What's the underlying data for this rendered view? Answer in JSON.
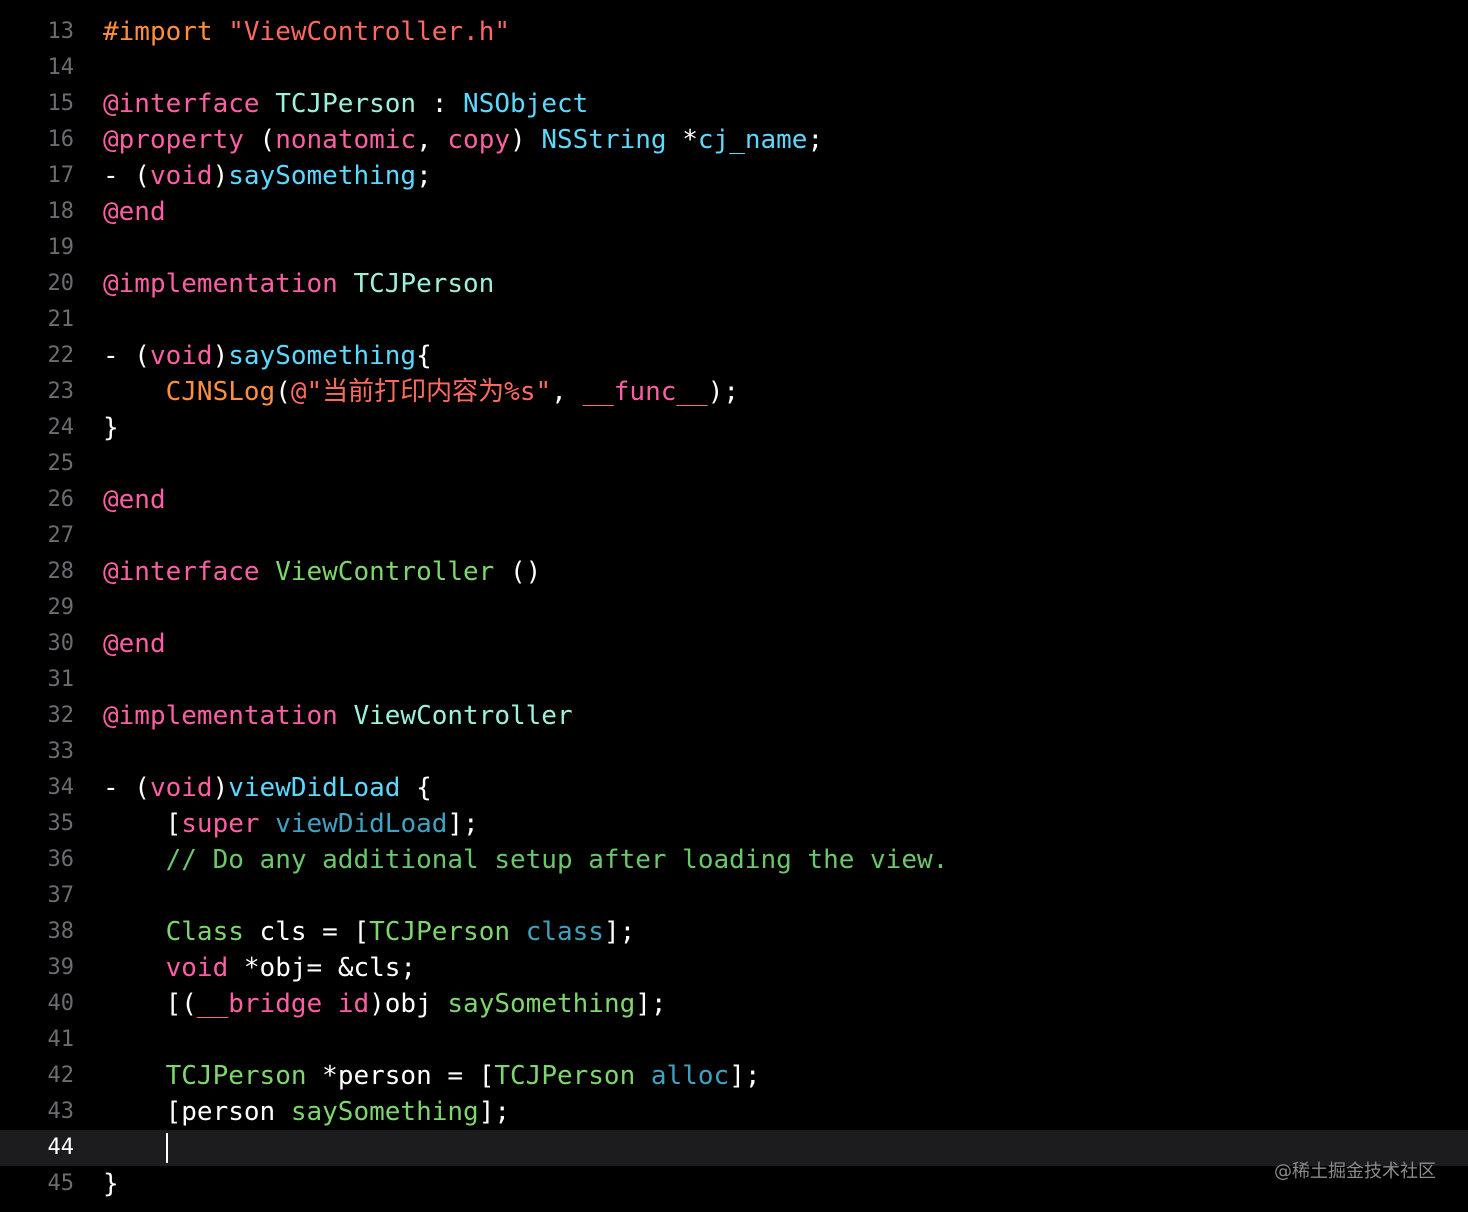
{
  "theme": {
    "background": "#000000",
    "current_line_background": "#1c1c1f",
    "line_number": "#6c6c72",
    "current_line_number": "#ffffff",
    "plain": "#ffffff",
    "keyword": "#fc5fa3",
    "string": "#fc6a5d",
    "comment": "#6bc76b",
    "type": "#5dd8ff",
    "class_name": "#9ef0dc",
    "project_name": "#67b7a4",
    "method_call": "#41a1c0",
    "preprocessor": "#fd8f3f",
    "green": "#7fd66f"
  },
  "editor": {
    "current_line": "44",
    "lines": [
      {
        "num": "13",
        "tokens": [
          {
            "t": "#import ",
            "c": "preprocessor"
          },
          {
            "t": "\"ViewController.h\"",
            "c": "string"
          }
        ]
      },
      {
        "num": "14",
        "tokens": []
      },
      {
        "num": "15",
        "tokens": [
          {
            "t": "@interface ",
            "c": "keyword"
          },
          {
            "t": "TCJPerson",
            "c": "class_name"
          },
          {
            "t": " : ",
            "c": "plain"
          },
          {
            "t": "NSObject",
            "c": "type"
          }
        ]
      },
      {
        "num": "16",
        "tokens": [
          {
            "t": "@property ",
            "c": "keyword"
          },
          {
            "t": "(",
            "c": "plain"
          },
          {
            "t": "nonatomic",
            "c": "keyword"
          },
          {
            "t": ", ",
            "c": "plain"
          },
          {
            "t": "copy",
            "c": "keyword"
          },
          {
            "t": ") ",
            "c": "plain"
          },
          {
            "t": "NSString",
            "c": "type"
          },
          {
            "t": " *",
            "c": "plain"
          },
          {
            "t": "cj_name",
            "c": "type"
          },
          {
            "t": ";",
            "c": "plain"
          }
        ]
      },
      {
        "num": "17",
        "tokens": [
          {
            "t": "- (",
            "c": "plain"
          },
          {
            "t": "void",
            "c": "keyword"
          },
          {
            "t": ")",
            "c": "plain"
          },
          {
            "t": "saySomething",
            "c": "type"
          },
          {
            "t": ";",
            "c": "plain"
          }
        ]
      },
      {
        "num": "18",
        "tokens": [
          {
            "t": "@end",
            "c": "keyword"
          }
        ]
      },
      {
        "num": "19",
        "tokens": []
      },
      {
        "num": "20",
        "tokens": [
          {
            "t": "@implementation ",
            "c": "keyword"
          },
          {
            "t": "TCJPerson",
            "c": "class_name"
          }
        ]
      },
      {
        "num": "21",
        "tokens": []
      },
      {
        "num": "22",
        "tokens": [
          {
            "t": "- (",
            "c": "plain"
          },
          {
            "t": "void",
            "c": "keyword"
          },
          {
            "t": ")",
            "c": "plain"
          },
          {
            "t": "saySomething",
            "c": "type"
          },
          {
            "t": "{",
            "c": "plain"
          }
        ]
      },
      {
        "num": "23",
        "tokens": [
          {
            "t": "    ",
            "c": "plain"
          },
          {
            "t": "CJNSLog",
            "c": "preprocessor"
          },
          {
            "t": "(",
            "c": "plain"
          },
          {
            "t": "@\"当前打印内容为%s\"",
            "c": "string"
          },
          {
            "t": ", ",
            "c": "plain"
          },
          {
            "t": "__func__",
            "c": "keyword"
          },
          {
            "t": ");",
            "c": "plain"
          }
        ]
      },
      {
        "num": "24",
        "tokens": [
          {
            "t": "}",
            "c": "plain"
          }
        ]
      },
      {
        "num": "25",
        "tokens": []
      },
      {
        "num": "26",
        "tokens": [
          {
            "t": "@end",
            "c": "keyword"
          }
        ]
      },
      {
        "num": "27",
        "tokens": []
      },
      {
        "num": "28",
        "tokens": [
          {
            "t": "@interface ",
            "c": "keyword"
          },
          {
            "t": "ViewController",
            "c": "green"
          },
          {
            "t": " ()",
            "c": "plain"
          }
        ]
      },
      {
        "num": "29",
        "tokens": []
      },
      {
        "num": "30",
        "tokens": [
          {
            "t": "@end",
            "c": "keyword"
          }
        ]
      },
      {
        "num": "31",
        "tokens": []
      },
      {
        "num": "32",
        "tokens": [
          {
            "t": "@implementation ",
            "c": "keyword"
          },
          {
            "t": "ViewController",
            "c": "class_name"
          }
        ]
      },
      {
        "num": "33",
        "tokens": []
      },
      {
        "num": "34",
        "tokens": [
          {
            "t": "- (",
            "c": "plain"
          },
          {
            "t": "void",
            "c": "keyword"
          },
          {
            "t": ")",
            "c": "plain"
          },
          {
            "t": "viewDidLoad",
            "c": "type"
          },
          {
            "t": " {",
            "c": "plain"
          }
        ]
      },
      {
        "num": "35",
        "tokens": [
          {
            "t": "    [",
            "c": "plain"
          },
          {
            "t": "super",
            "c": "keyword"
          },
          {
            "t": " ",
            "c": "plain"
          },
          {
            "t": "viewDidLoad",
            "c": "method_call"
          },
          {
            "t": "];",
            "c": "plain"
          }
        ]
      },
      {
        "num": "36",
        "tokens": [
          {
            "t": "    ",
            "c": "plain"
          },
          {
            "t": "// Do any additional setup after loading the view.",
            "c": "comment"
          }
        ]
      },
      {
        "num": "37",
        "tokens": []
      },
      {
        "num": "38",
        "tokens": [
          {
            "t": "    ",
            "c": "plain"
          },
          {
            "t": "Class",
            "c": "green"
          },
          {
            "t": " cls = [",
            "c": "plain"
          },
          {
            "t": "TCJPerson",
            "c": "green"
          },
          {
            "t": " ",
            "c": "plain"
          },
          {
            "t": "class",
            "c": "method_call"
          },
          {
            "t": "];",
            "c": "plain"
          }
        ]
      },
      {
        "num": "39",
        "tokens": [
          {
            "t": "    ",
            "c": "plain"
          },
          {
            "t": "void",
            "c": "keyword"
          },
          {
            "t": " *obj= &cls;",
            "c": "plain"
          }
        ]
      },
      {
        "num": "40",
        "tokens": [
          {
            "t": "    [(",
            "c": "plain"
          },
          {
            "t": "__bridge",
            "c": "keyword"
          },
          {
            "t": " ",
            "c": "plain"
          },
          {
            "t": "id",
            "c": "keyword"
          },
          {
            "t": ")obj ",
            "c": "plain"
          },
          {
            "t": "saySomething",
            "c": "green"
          },
          {
            "t": "];",
            "c": "plain"
          }
        ]
      },
      {
        "num": "41",
        "tokens": []
      },
      {
        "num": "42",
        "tokens": [
          {
            "t": "    ",
            "c": "plain"
          },
          {
            "t": "TCJPerson",
            "c": "green"
          },
          {
            "t": " *person = [",
            "c": "plain"
          },
          {
            "t": "TCJPerson",
            "c": "green"
          },
          {
            "t": " ",
            "c": "plain"
          },
          {
            "t": "alloc",
            "c": "method_call"
          },
          {
            "t": "];",
            "c": "plain"
          }
        ]
      },
      {
        "num": "43",
        "tokens": [
          {
            "t": "    [person ",
            "c": "plain"
          },
          {
            "t": "saySomething",
            "c": "green"
          },
          {
            "t": "];",
            "c": "plain"
          }
        ]
      },
      {
        "num": "44",
        "tokens": []
      },
      {
        "num": "45",
        "tokens": [
          {
            "t": "}",
            "c": "plain"
          }
        ]
      }
    ]
  },
  "watermark": "@稀土掘金技术社区"
}
